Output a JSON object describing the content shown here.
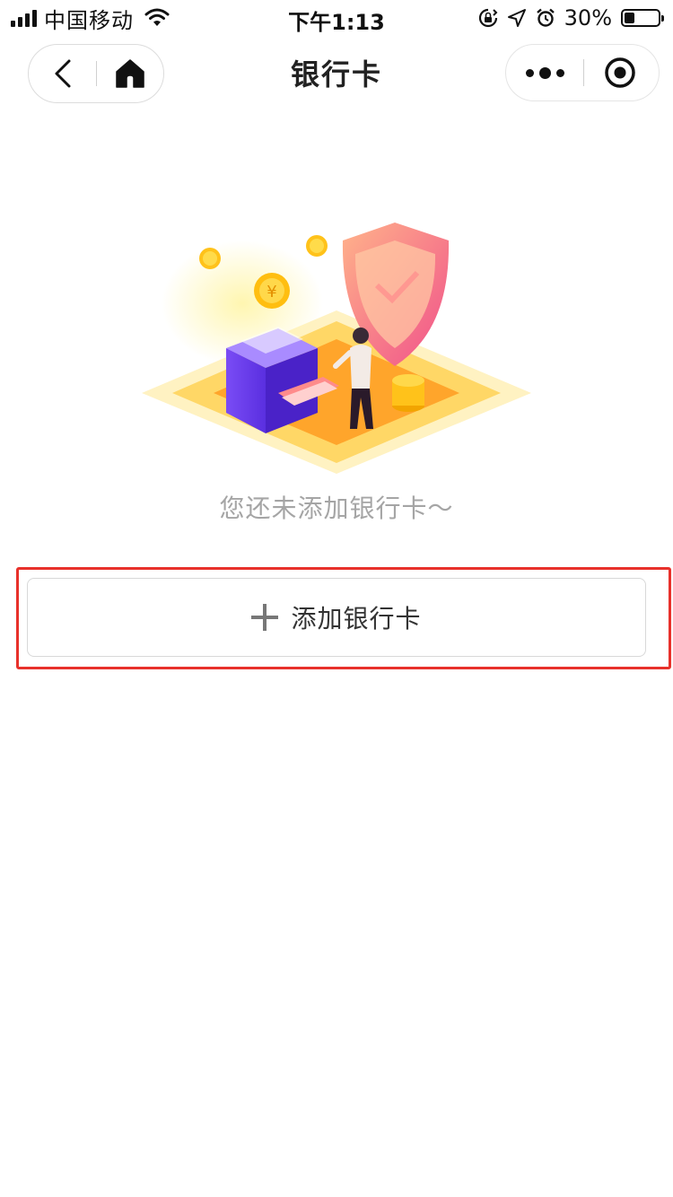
{
  "status_bar": {
    "carrier": "中国移动",
    "time": "下午1:13",
    "battery_percent": "30%",
    "battery_level": 0.3
  },
  "nav": {
    "title": "银行卡"
  },
  "empty_state": {
    "message": "您还未添加银行卡～"
  },
  "actions": {
    "add_card_label": "添加银行卡"
  },
  "colors": {
    "highlight": "#e8312b",
    "card_border": "#d8d8d8",
    "hint_text": "#a5a5a5"
  }
}
